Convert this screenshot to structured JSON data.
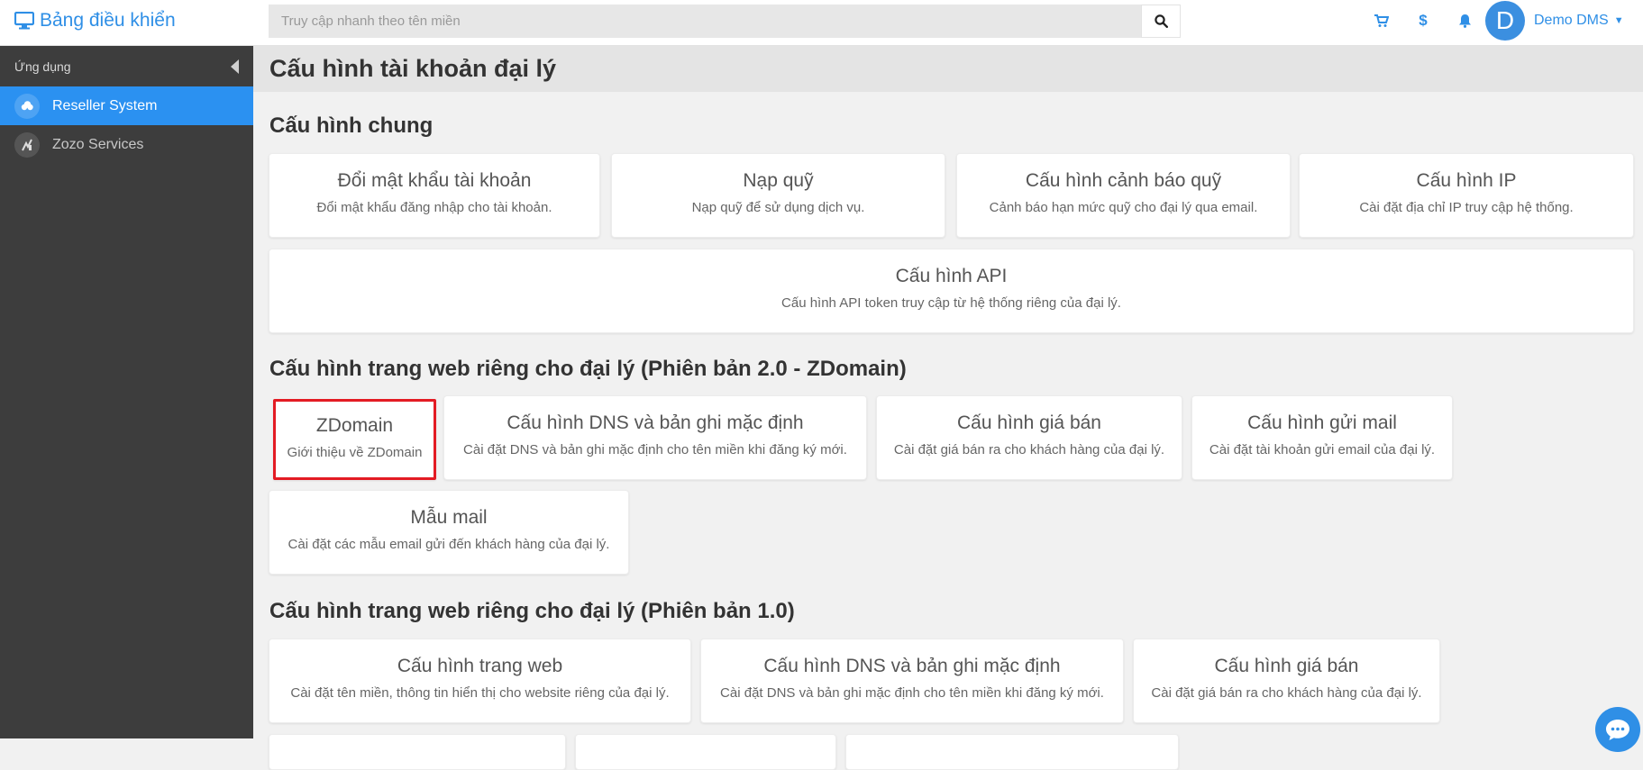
{
  "header": {
    "brand": "Bảng điều khiển",
    "search_placeholder": "Truy cập nhanh theo tên miền",
    "user_initial": "D",
    "user_name": "Demo DMS"
  },
  "sidebar": {
    "heading": "Ứng dụng",
    "items": [
      {
        "label": "Reseller System",
        "active": true
      },
      {
        "label": "Zozo Services",
        "active": false
      }
    ]
  },
  "page": {
    "title": "Cấu hình tài khoản đại lý"
  },
  "sections": [
    {
      "title": "Cấu hình chung",
      "cards": [
        {
          "title": "Đổi mật khẩu tài khoản",
          "desc": "Đổi mật khẩu đăng nhập cho tài khoản."
        },
        {
          "title": "Nạp quỹ",
          "desc": "Nạp quỹ để sử dụng dịch vụ."
        },
        {
          "title": "Cấu hình cảnh báo quỹ",
          "desc": "Cảnh báo hạn mức quỹ cho đại lý qua email."
        },
        {
          "title": "Cấu hình IP",
          "desc": "Cài đặt địa chỉ IP truy cập hệ thống."
        },
        {
          "title": "Cấu hình API",
          "desc": "Cấu hình API token truy cập từ hệ thống riêng của đại lý."
        }
      ]
    },
    {
      "title": "Cấu hình trang web riêng cho đại lý (Phiên bản 2.0 - ZDomain)",
      "cards": [
        {
          "title": "ZDomain",
          "desc": "Giới thiệu về ZDomain"
        },
        {
          "title": "Cấu hình DNS và bản ghi mặc định",
          "desc": "Cài đặt DNS và bản ghi mặc định cho tên miền khi đăng ký mới."
        },
        {
          "title": "Cấu hình giá bán",
          "desc": "Cài đặt giá bán ra cho khách hàng của đại lý."
        },
        {
          "title": "Cấu hình gửi mail",
          "desc": "Cài đặt tài khoản gửi email của đại lý."
        },
        {
          "title": "Mẫu mail",
          "desc": "Cài đặt các mẫu email gửi đến khách hàng của đại lý."
        }
      ]
    },
    {
      "title": "Cấu hình trang web riêng cho đại lý (Phiên bản 1.0)",
      "cards": [
        {
          "title": "Cấu hình trang web",
          "desc": "Cài đặt tên miền, thông tin hiển thị cho website riêng của đại lý."
        },
        {
          "title": "Cấu hình DNS và bản ghi mặc định",
          "desc": "Cài đặt DNS và bản ghi mặc định cho tên miền khi đăng ký mới."
        },
        {
          "title": "Cấu hình giá bán",
          "desc": "Cài đặt giá bán ra cho khách hàng của đại lý."
        }
      ]
    }
  ],
  "colors": {
    "accent": "#2f8fe6",
    "sidebar_bg": "#3d3d3d",
    "sidebar_active": "#2b91f1",
    "highlight_border": "#e31b23"
  },
  "icons": [
    "desktop-icon",
    "search-icon",
    "cart-icon",
    "dollar-icon",
    "bell-icon",
    "cloud-icon",
    "chart-icon",
    "chat-icon"
  ]
}
